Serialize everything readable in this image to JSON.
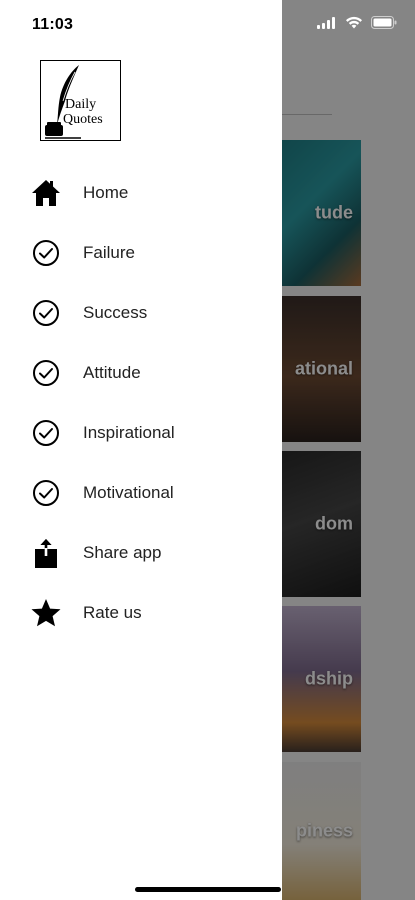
{
  "status_bar": {
    "time": "11:03"
  },
  "drawer": {
    "logo": {
      "line1": "Daily",
      "line2": "Quotes"
    },
    "items": [
      {
        "label": "Home",
        "icon": "home-icon"
      },
      {
        "label": "Failure",
        "icon": "check-circle-icon"
      },
      {
        "label": "Success",
        "icon": "check-circle-icon"
      },
      {
        "label": "Attitude",
        "icon": "check-circle-icon"
      },
      {
        "label": "Inspirational",
        "icon": "check-circle-icon"
      },
      {
        "label": "Motivational",
        "icon": "check-circle-icon"
      },
      {
        "label": "Share app",
        "icon": "share-icon"
      },
      {
        "label": "Rate us",
        "icon": "star-icon"
      }
    ]
  },
  "background": {
    "categories": [
      "tude",
      "ational",
      "dom",
      "dship",
      "piness"
    ]
  }
}
